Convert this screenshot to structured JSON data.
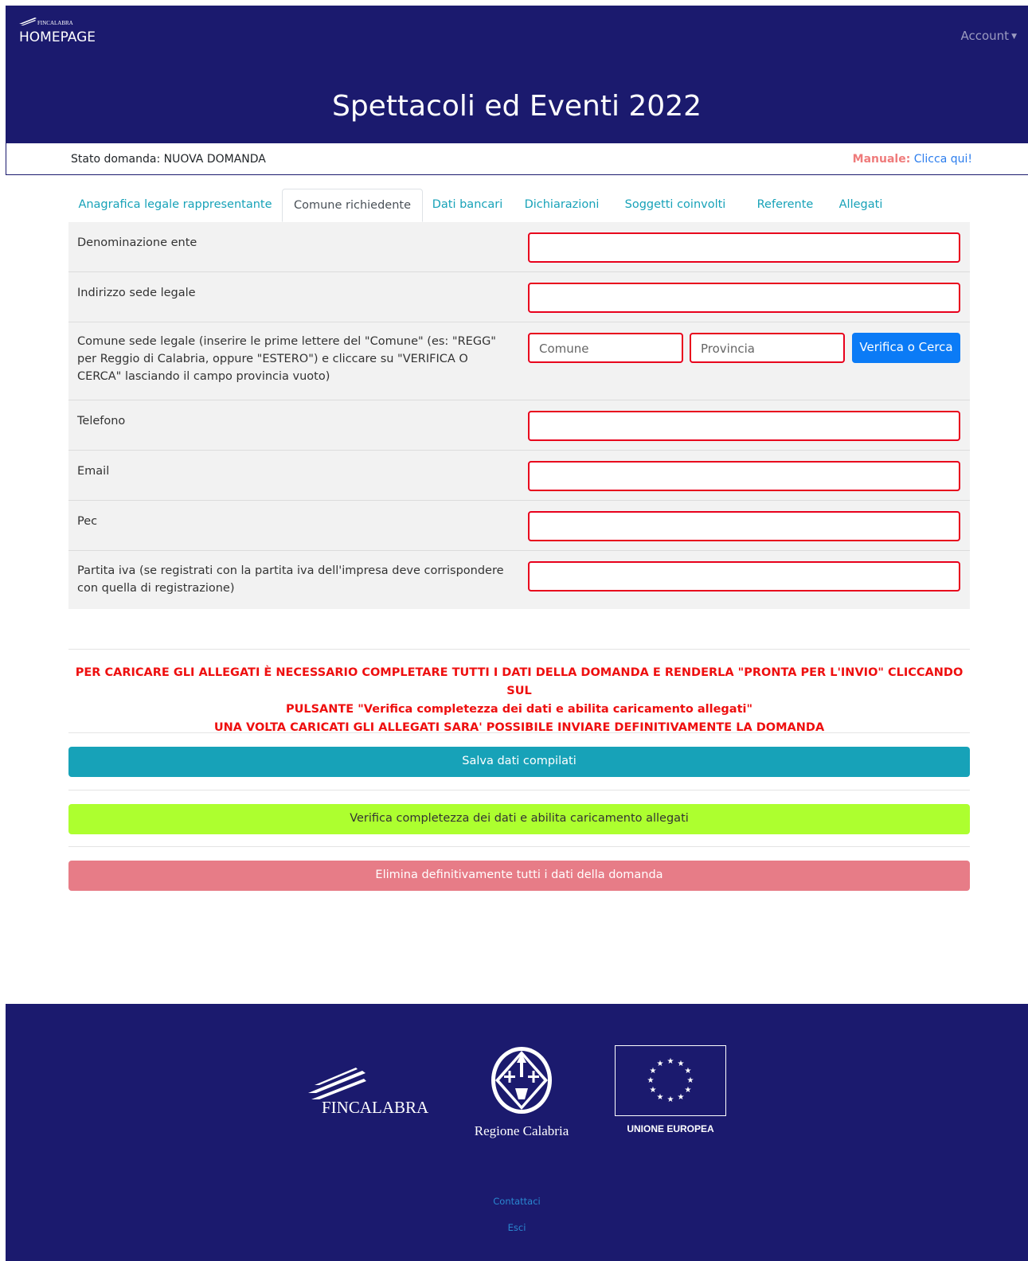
{
  "header": {
    "brand_small": "FINCALABRA",
    "home_label": "HOMEPAGE",
    "account_label": "Account",
    "title": "Spettacoli ed Eventi 2022"
  },
  "status": {
    "stato_text": "Stato domanda: NUOVA DOMANDA",
    "manuale_label": "Manuale:",
    "manuale_link": "Clicca qui!"
  },
  "tabs": [
    {
      "label": "Anagrafica legale rappresentante"
    },
    {
      "label": "Comune richiedente",
      "active": true
    },
    {
      "label": "Dati bancari"
    },
    {
      "label": "Dichiarazioni"
    },
    {
      "label": "Soggetti coinvolti"
    },
    {
      "label": "Referente"
    },
    {
      "label": "Allegati"
    }
  ],
  "form": {
    "denominazione": {
      "label": "Denominazione ente",
      "value": ""
    },
    "indirizzo": {
      "label": "Indirizzo sede legale",
      "value": ""
    },
    "comune": {
      "label": "Comune sede legale (inserire le prime lettere del \"Comune\" (es: \"REGG\" per Reggio di Calabria, oppure \"ESTERO\") e cliccare su \"VERIFICA O CERCA\" lasciando il campo provincia vuoto)",
      "comune_placeholder": "Comune",
      "provincia_placeholder": "Provincia",
      "button_label": "Verifica o Cerca"
    },
    "telefono": {
      "label": "Telefono",
      "value": ""
    },
    "email": {
      "label": "Email",
      "value": ""
    },
    "pec": {
      "label": "Pec",
      "value": ""
    },
    "partita_iva": {
      "label": "Partita iva (se registrati con la partita iva dell'impresa deve corrispondere con quella di registrazione)",
      "value": ""
    }
  },
  "warning": {
    "line1": "PER CARICARE GLI ALLEGATI È NECESSARIO COMPLETARE TUTTI I DATI DELLA DOMANDA E RENDERLA \"PRONTA PER L'INVIO\" CLICCANDO SUL",
    "line2": "PULSANTE \"Verifica completezza dei dati e abilita caricamento allegati\"",
    "line3": "UNA VOLTA CARICATI GLI ALLEGATI SARA' POSSIBILE INVIARE DEFINITIVAMENTE LA DOMANDA"
  },
  "buttons": {
    "save": "Salva dati compilati",
    "verify": "Verifica completezza dei dati e abilita caricamento allegati",
    "delete": "Elimina definitivamente tutti i dati della domanda"
  },
  "footer": {
    "fincalabra": "FINCALABRA",
    "regione": "Regione Calabria",
    "ue": "UNIONE EUROPEA",
    "contattaci": "Contattaci",
    "esci": "Esci"
  },
  "colors": {
    "navy": "#1b1a6e",
    "required_border": "#e8001c",
    "save_button": "#17a2b8",
    "verify_button": "#adff2f",
    "delete_button": "#e77c87",
    "search_button": "#0b7bf6"
  }
}
